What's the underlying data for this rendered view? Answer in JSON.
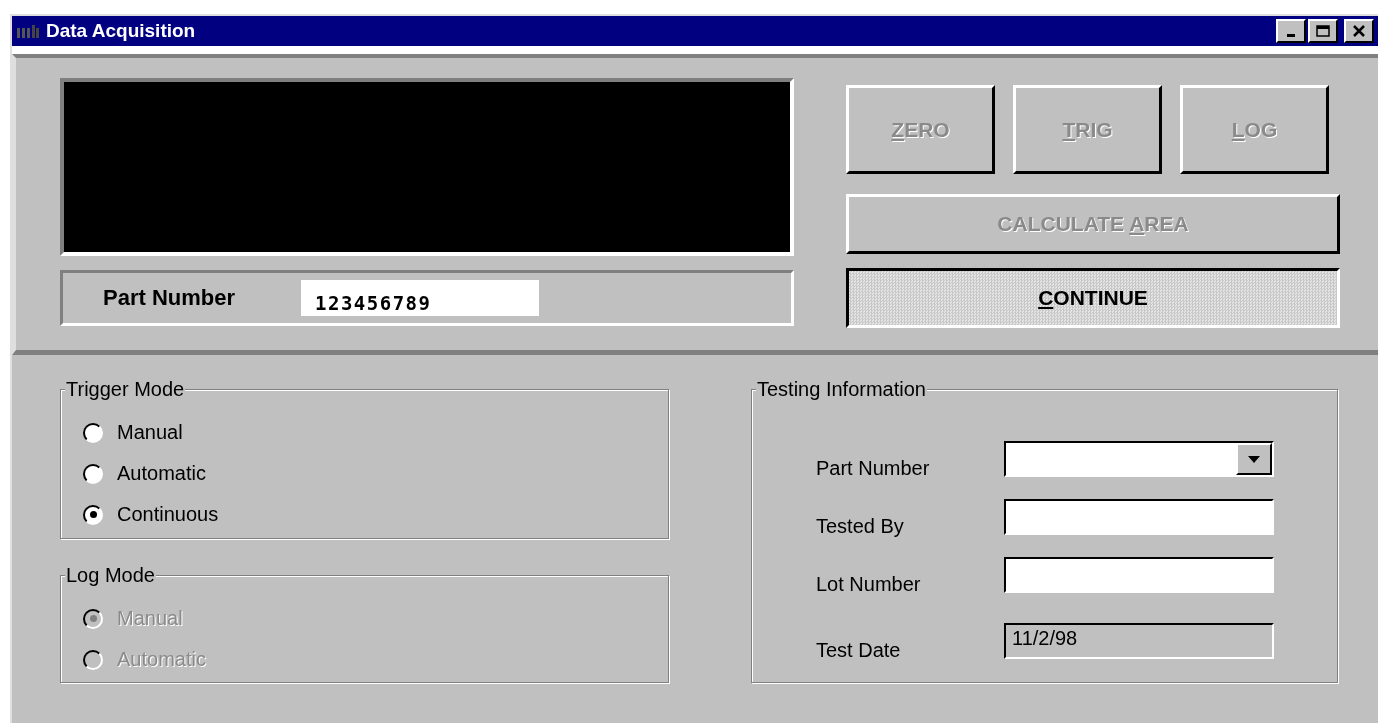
{
  "window": {
    "title": "Data Acquisition"
  },
  "display": {
    "part_label": "Part Number",
    "part_value": "123456789"
  },
  "buttons": [
    {
      "access_key": "Z",
      "label_rest": "ERO",
      "disabled": true,
      "pressed": false
    },
    {
      "access_key": "T",
      "label_rest": "RIG",
      "disabled": true,
      "pressed": false
    },
    {
      "access_key": "L",
      "label_rest": "OG",
      "disabled": true,
      "pressed": false
    },
    {
      "label_start": "CALCULATE ",
      "access_key": "A",
      "label_rest": "REA",
      "disabled": true,
      "pressed": false
    },
    {
      "access_key": "C",
      "label_rest": "ONTINUE",
      "disabled": false,
      "pressed": true
    }
  ],
  "trigger_mode": {
    "title": "Trigger Mode",
    "disabled": false,
    "options": [
      {
        "label": "Manual",
        "selected": false
      },
      {
        "label": "Automatic",
        "selected": false
      },
      {
        "label": "Continuous",
        "selected": true
      }
    ]
  },
  "log_mode": {
    "title": "Log Mode",
    "disabled": true,
    "options": [
      {
        "label": "Manual",
        "selected": true
      },
      {
        "label": "Automatic",
        "selected": false
      }
    ]
  },
  "testing_information": {
    "title": "Testing Information",
    "fields": [
      {
        "label": "Part Number",
        "kind": "combo"
      },
      {
        "label": "Tested By",
        "kind": "text"
      },
      {
        "label": "Lot Number",
        "kind": "text"
      },
      {
        "label": "Test Date",
        "kind": "readonly",
        "value": "11/2/98"
      }
    ]
  }
}
